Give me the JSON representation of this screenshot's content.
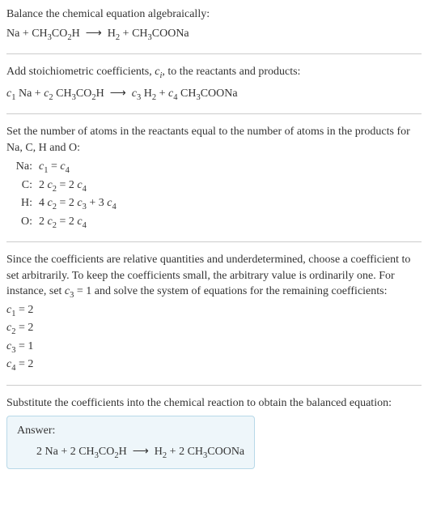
{
  "step1": {
    "title": "Balance the chemical equation algebraically:",
    "equation_html": "Na + CH<sub>3</sub>CO<sub>2</sub>H&nbsp;&nbsp;⟶&nbsp;&nbsp;H<sub>2</sub> + CH<sub>3</sub>COONa"
  },
  "step2": {
    "title_html": "Add stoichiometric coefficients, <i>c<sub>i</sub></i>, to the reactants and products:",
    "equation_html": "<i>c</i><sub>1</sub> Na + <i>c</i><sub>2</sub> CH<sub>3</sub>CO<sub>2</sub>H&nbsp;&nbsp;⟶&nbsp;&nbsp;<i>c</i><sub>3</sub> H<sub>2</sub> + <i>c</i><sub>4</sub> CH<sub>3</sub>COONa"
  },
  "step3": {
    "title": "Set the number of atoms in the reactants equal to the number of atoms in the products for Na, C, H and O:",
    "rows": [
      {
        "label": "Na:",
        "eq_html": "<i>c</i><sub>1</sub> = <i>c</i><sub>4</sub>"
      },
      {
        "label": "C:",
        "eq_html": "2 <i>c</i><sub>2</sub> = 2 <i>c</i><sub>4</sub>"
      },
      {
        "label": "H:",
        "eq_html": "4 <i>c</i><sub>2</sub> = 2 <i>c</i><sub>3</sub> + 3 <i>c</i><sub>4</sub>"
      },
      {
        "label": "O:",
        "eq_html": "2 <i>c</i><sub>2</sub> = 2 <i>c</i><sub>4</sub>"
      }
    ]
  },
  "step4": {
    "title_html": "Since the coefficients are relative quantities and underdetermined, choose a coefficient to set arbitrarily. To keep the coefficients small, the arbitrary value is ordinarily one. For instance, set <i>c</i><sub>3</sub> = 1 and solve the system of equations for the remaining coefficients:",
    "lines": [
      {
        "html": "<i>c</i><sub>1</sub> = 2"
      },
      {
        "html": "<i>c</i><sub>2</sub> = 2"
      },
      {
        "html": "<i>c</i><sub>3</sub> = 1"
      },
      {
        "html": "<i>c</i><sub>4</sub> = 2"
      }
    ]
  },
  "step5": {
    "title": "Substitute the coefficients into the chemical reaction to obtain the balanced equation:"
  },
  "answer": {
    "label": "Answer:",
    "equation_html": "2 Na + 2 CH<sub>3</sub>CO<sub>2</sub>H&nbsp;&nbsp;⟶&nbsp;&nbsp;H<sub>2</sub> + 2 CH<sub>3</sub>COONa"
  }
}
